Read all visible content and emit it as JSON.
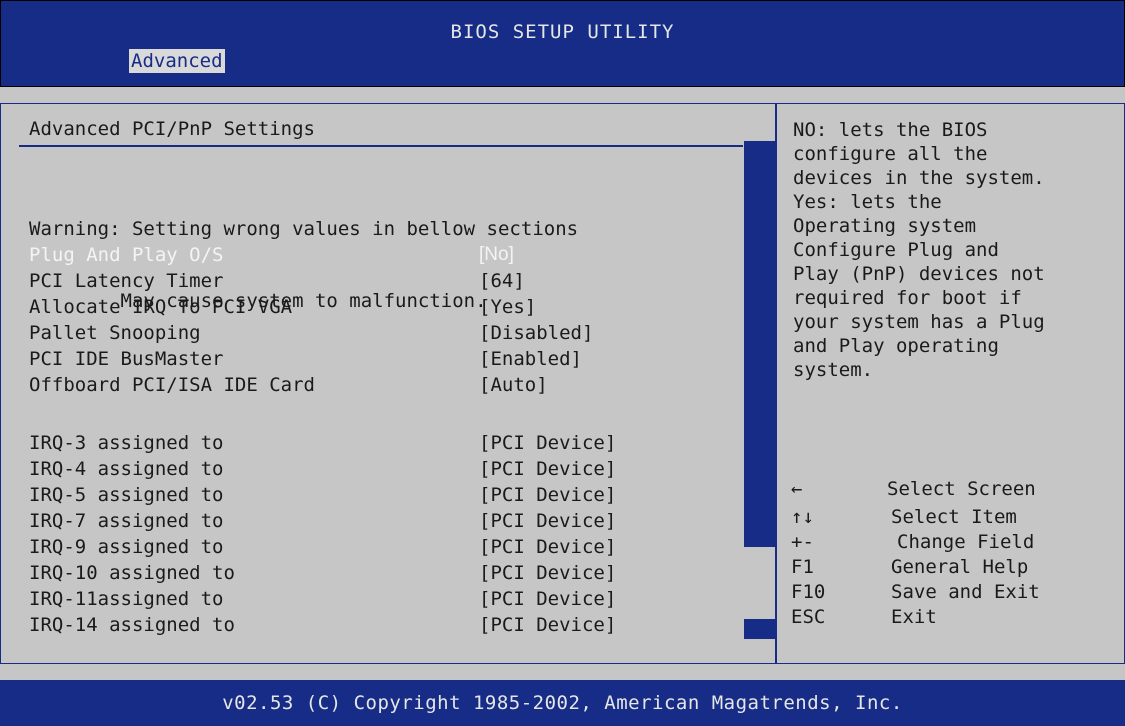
{
  "header": {
    "title": "BIOS SETUP UTILITY",
    "active_tab": "Advanced"
  },
  "main": {
    "section_title": "Advanced PCI/PnP Settings",
    "warning_line1": "Warning: Setting wrong values in bellow sections",
    "warning_line2": "        May cause system to malfunction.",
    "settings": [
      {
        "label": "Plug And Play O/S",
        "value": "[No]",
        "selected": true
      },
      {
        "label": "PCI Latency Timer",
        "value": "[64]"
      },
      {
        "label": "Allocate IRQ To PCI VGA",
        "value": "[Yes]"
      },
      {
        "label": "Pallet Snooping",
        "value": "[Disabled]"
      },
      {
        "label": "PCI IDE BusMaster",
        "value": "[Enabled]"
      },
      {
        "label": "Offboard PCI/ISA IDE Card",
        "value": "[Auto]"
      }
    ],
    "irq_settings": [
      {
        "label": "IRQ-3 assigned to",
        "value": "[PCI Device]"
      },
      {
        "label": "IRQ-4 assigned to",
        "value": "[PCI Device]"
      },
      {
        "label": "IRQ-5 assigned to",
        "value": "[PCI Device]"
      },
      {
        "label": "IRQ-7 assigned to",
        "value": "[PCI Device]"
      },
      {
        "label": "IRQ-9 assigned to",
        "value": "[PCI Device]"
      },
      {
        "label": "IRQ-10 assigned to",
        "value": "[PCI Device]"
      },
      {
        "label": "IRQ-11assigned to",
        "value": "[PCI Device]"
      },
      {
        "label": "IRQ-14 assigned to",
        "value": "[PCI Device]"
      }
    ]
  },
  "help": {
    "text": "NO: lets the BIOS\nconfigure all the\ndevices in the system.\nYes: lets the\nOperating system\nConfigure Plug and\nPlay (PnP) devices not\nrequired for boot if\nyour system has a Plug\nand Play operating\nsystem.",
    "keys": [
      {
        "key": "←",
        "desc": "Select Screen"
      },
      {
        "key": "↑↓",
        "desc": "Select Item"
      },
      {
        "key": "+-",
        "desc": "Change Field"
      },
      {
        "key": "F1",
        "desc": "General Help"
      },
      {
        "key": "F10",
        "desc": "Save and Exit"
      },
      {
        "key": "ESC",
        "desc": "Exit"
      }
    ]
  },
  "footer": {
    "copyright": "v02.53 (C) Copyright 1985-2002, American Magatrends, Inc."
  },
  "colors": {
    "bar_blue": "#162c86",
    "panel_gray": "#c6c6c6",
    "highlight_text": "#f4f4f4"
  }
}
